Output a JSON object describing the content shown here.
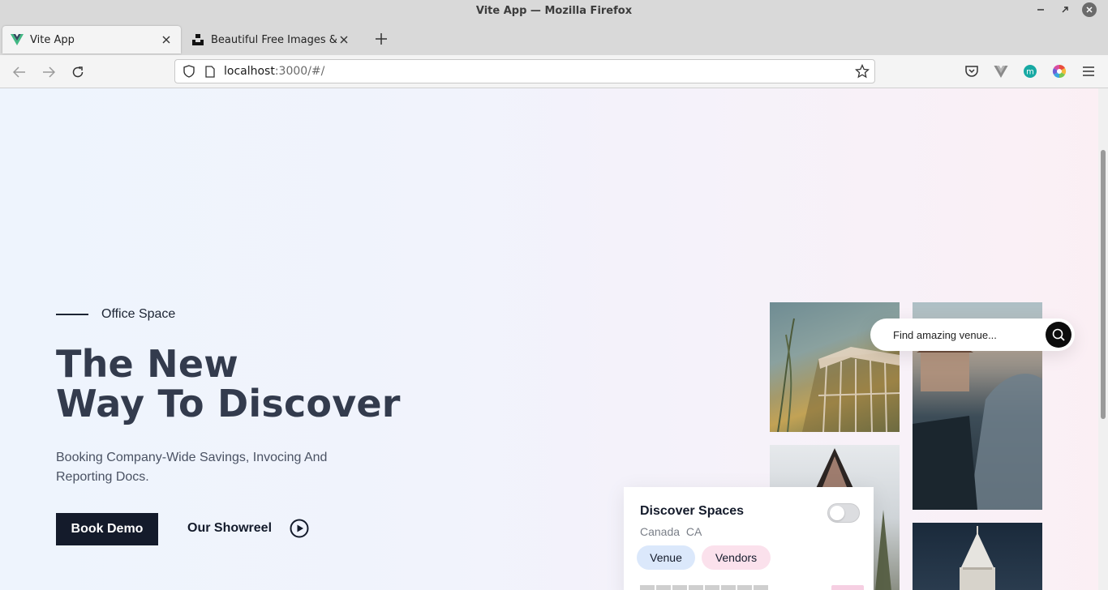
{
  "window": {
    "title": "Vite App — Mozilla Firefox"
  },
  "tabs": [
    {
      "label": "Vite App",
      "icon": "vue-logo-icon"
    },
    {
      "label": "Beautiful Free Images & Pictures",
      "icon": "unsplash-logo-icon"
    }
  ],
  "address": {
    "host": "localhost",
    "path": ":3000/#/"
  },
  "hero": {
    "eyebrow": "Office Space",
    "title_line1": "The New",
    "title_line2": "Way To Discover",
    "subtitle": "Booking Company-Wide Savings, Invocing And Reporting Docs.",
    "book_demo": "Book Demo",
    "showreel": "Our Showreel"
  },
  "search": {
    "placeholder": "Find amazing venue..."
  },
  "discover": {
    "title": "Discover Spaces",
    "location": "Canada CA",
    "chips": [
      "Venue",
      "Vendors"
    ]
  },
  "colors": {
    "primary_dark": "#141b2b",
    "venue_chip": "#dbe8fb",
    "vendors_chip": "#fbe1ec"
  }
}
